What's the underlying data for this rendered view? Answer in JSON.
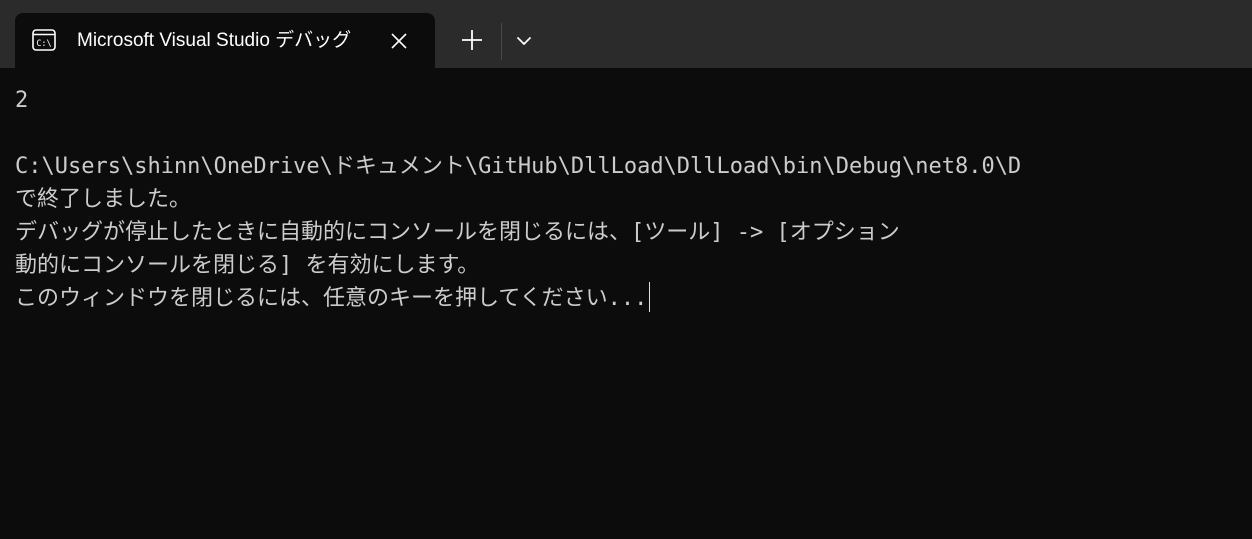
{
  "tab": {
    "title": "Microsoft Visual Studio デバッグ",
    "icon": "terminal-icon",
    "close_icon": "close-icon"
  },
  "tabbar": {
    "new_tab_icon": "plus-icon",
    "dropdown_icon": "chevron-down-icon"
  },
  "colors": {
    "tabbar_bg": "#2b2b2b",
    "console_bg": "#0c0c0c",
    "console_text": "#cccccc"
  },
  "console": {
    "lines": [
      "2",
      "",
      "C:\\Users\\shinn\\OneDrive\\ドキュメント\\GitHub\\DllLoad\\DllLoad\\bin\\Debug\\net8.0\\D",
      "で終了しました。",
      "デバッグが停止したときに自動的にコンソールを閉じるには、[ツール] -> [オプション",
      "動的にコンソールを閉じる] を有効にします。",
      "このウィンドウを閉じるには、任意のキーを押してください..."
    ]
  }
}
